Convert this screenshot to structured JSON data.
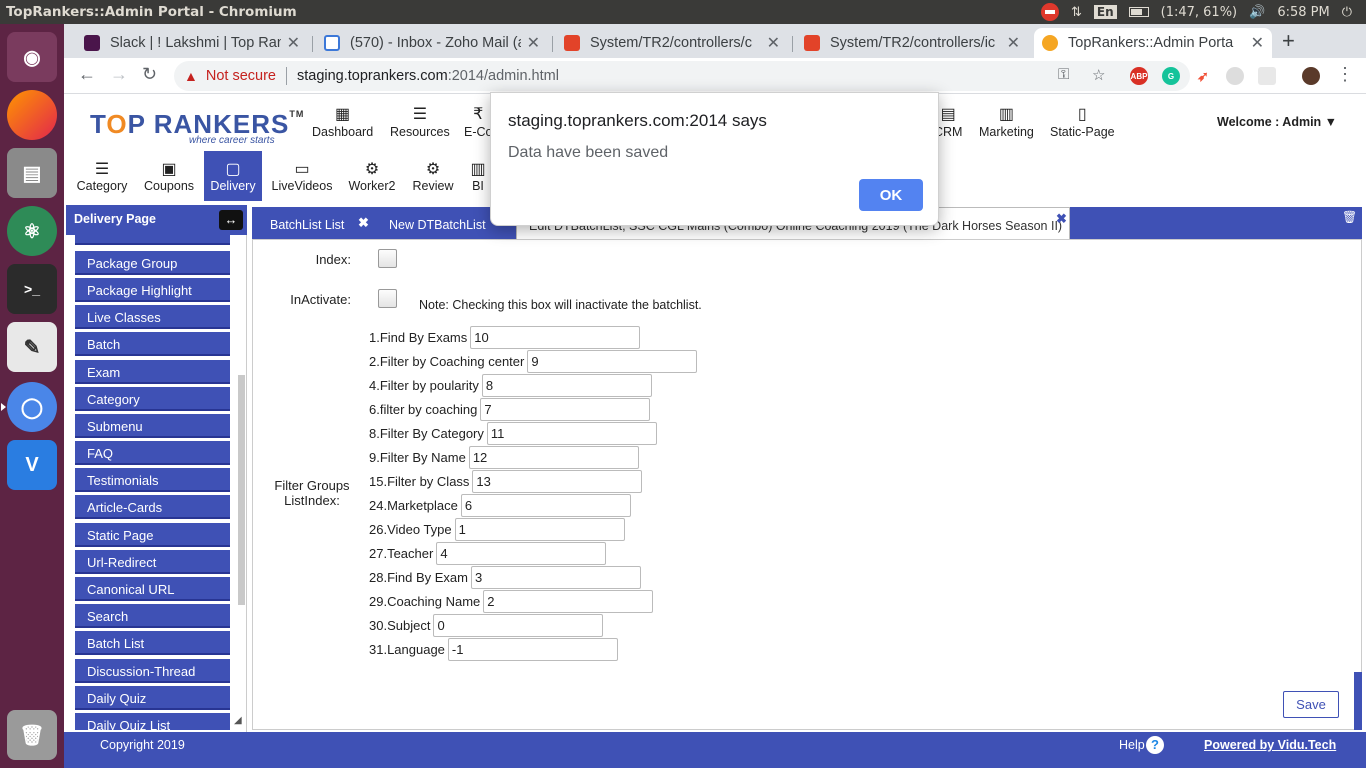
{
  "os": {
    "window_title": "TopRankers::Admin Portal - Chromium",
    "lang": "En",
    "battery": "(1:47, 61%)",
    "clock": "6:58 PM"
  },
  "browser": {
    "tabs": [
      {
        "label": "Slack | ! Lakshmi | Top Ran",
        "favicon_color": "#4a154b"
      },
      {
        "label": "(570) - Inbox - Zoho Mail (a",
        "favicon_color": "#3c78d8"
      },
      {
        "label": "System/TR2/controllers/c",
        "favicon_color": "#e24329"
      },
      {
        "label": "System/TR2/controllers/ic",
        "favicon_color": "#e24329"
      },
      {
        "label": "TopRankers::Admin Porta",
        "favicon_color": "#f5a623"
      }
    ],
    "security_label": "Not secure",
    "url_host": "staging.toprankers.com",
    "url_path": ":2014/admin.html"
  },
  "header": {
    "logo_t": "T",
    "logo_o": "O",
    "logo_rest": "P RANKERS",
    "logo_tm": "TM",
    "tagline": "where career starts",
    "top_nav": [
      "Dashboard",
      "Resources",
      "E-Co",
      "CRM",
      "Marketing",
      "Static-Page"
    ],
    "welcome": "Welcome : Admin",
    "sub_nav": [
      "Category",
      "Coupons",
      "Delivery",
      "LiveVideos",
      "Worker2",
      "Review",
      "BI"
    ]
  },
  "sidebar": {
    "title": "Delivery Page",
    "items": [
      "Package Group",
      "Package Highlight",
      "Live Classes",
      "Batch",
      "Exam",
      "Category",
      "Submenu",
      "FAQ",
      "Testimonials",
      "Article-Cards",
      "Static Page",
      "Url-Redirect",
      "Canonical URL",
      "Search",
      "Batch List",
      "Discussion-Thread",
      "Daily Quiz",
      "Daily Quiz List"
    ]
  },
  "main_tabs": {
    "tab1": "BatchList List",
    "tab2": "New DTBatchList",
    "tab3": "Edit DTBatchList, SSC CGL Mains (Combo) Online Coaching 2019 (The Dark Horses Season II)"
  },
  "form": {
    "index_label": "Index:",
    "inactivate_label": "InActivate:",
    "inactivate_note": "Note: Checking this box will inactivate the batchlist.",
    "filter_groups_label_1": "Filter Groups",
    "filter_groups_label_2": "ListIndex:",
    "filters": [
      {
        "label": "1.Find By Exams",
        "value": "10"
      },
      {
        "label": "2.Filter by Coaching center",
        "value": "9"
      },
      {
        "label": "4.Filter by poularity",
        "value": "8"
      },
      {
        "label": "6.filter by coaching",
        "value": "7"
      },
      {
        "label": "8.Filter By Category",
        "value": "11"
      },
      {
        "label": "9.Filter By Name",
        "value": "12"
      },
      {
        "label": "15.Filter by Class",
        "value": "13"
      },
      {
        "label": "24.Marketplace",
        "value": "6"
      },
      {
        "label": "26.Video Type",
        "value": "1"
      },
      {
        "label": "27.Teacher",
        "value": "4"
      },
      {
        "label": "28.Find By Exam",
        "value": "3"
      },
      {
        "label": "29.Coaching Name",
        "value": "2"
      },
      {
        "label": "30.Subject",
        "value": "0"
      },
      {
        "label": "31.Language",
        "value": "-1"
      }
    ],
    "save_label": "Save"
  },
  "footer": {
    "copyright": "Copyright 2019",
    "help": "Help",
    "help_icon": "?",
    "powered": "Powered by Vidu.Tech"
  },
  "dialog": {
    "title": "staging.toprankers.com:2014 says",
    "message": "Data have been saved",
    "ok_label": "OK"
  },
  "colors": {
    "primary": "#3f51b5",
    "launcher": "#5d2444",
    "dialog_button": "#5383f1",
    "not_secure": "#c5221f"
  }
}
